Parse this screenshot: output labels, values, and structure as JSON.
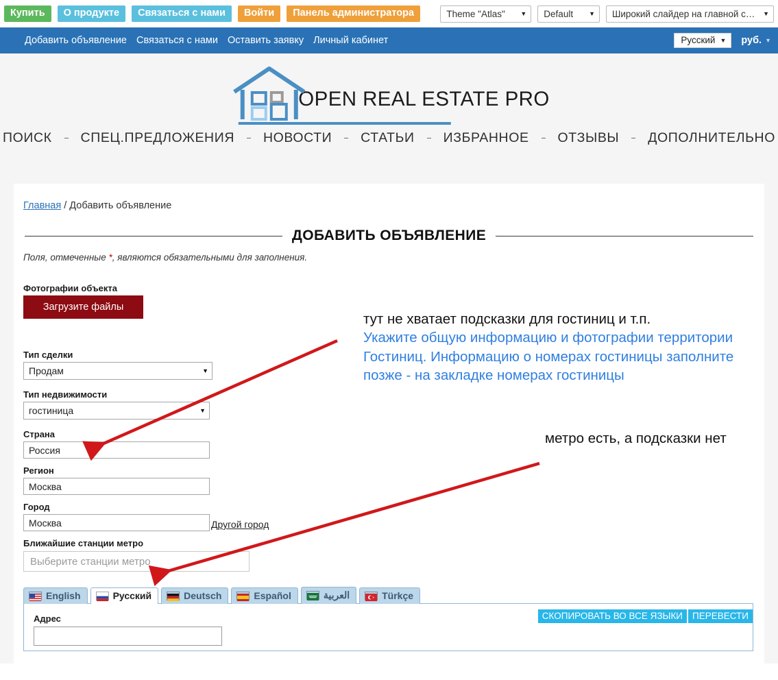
{
  "admin_bar": {
    "buttons": [
      {
        "label": "Купить",
        "color": "#5cb85c"
      },
      {
        "label": "О продукте",
        "color": "#5bc0de"
      },
      {
        "label": "Связаться с нами",
        "color": "#5bc0de"
      },
      {
        "label": "Войти",
        "color": "#efa03b"
      },
      {
        "label": "Панель администратора",
        "color": "#efa03b"
      }
    ],
    "selects": [
      {
        "value": "Theme \"Atlas\""
      },
      {
        "value": "Default"
      },
      {
        "value": "Широкий слайдер на главной страни"
      }
    ]
  },
  "top_nav": {
    "links": [
      "Добавить объявление",
      "Связаться с нами",
      "Оставить заявку",
      "Личный кабинет"
    ],
    "language": "Русский",
    "currency": "руб."
  },
  "logo": {
    "text": "OPEN REAL ESTATE PRO"
  },
  "main_nav": {
    "items": [
      "ПОИСК",
      "СПЕЦ.ПРЕДЛОЖЕНИЯ",
      "НОВОСТИ",
      "СТАТЬИ",
      "ИЗБРАННОЕ",
      "ОТЗЫВЫ",
      "ДОПОЛНИТЕЛЬНО"
    ]
  },
  "breadcrumb": {
    "home": "Главная",
    "separator": "/",
    "current": "Добавить объявление"
  },
  "page": {
    "title": "ДОБАВИТЬ ОБЪЯВЛЕНИЕ",
    "required_note_before": "Поля, отмеченные ",
    "required_star": "*",
    "required_note_after": ", являются обязательными для заполнения."
  },
  "form": {
    "photos_label": "Фотографии объекта",
    "upload_button": "Загрузите файлы",
    "deal_type_label": "Тип сделки",
    "deal_type_value": "Продам",
    "property_type_label": "Тип недвижимости",
    "property_type_value": "гостиница",
    "country_label": "Страна",
    "country_value": "Россия",
    "region_label": "Регион",
    "region_value": "Москва",
    "city_label": "Город",
    "city_value": "Москва",
    "other_city_link": "Другой город",
    "metro_label": "Ближайшие станции метро",
    "metro_placeholder": "Выберите станции метро"
  },
  "lang_tabs": [
    {
      "label": "English",
      "flag": "us",
      "active": false
    },
    {
      "label": "Русский",
      "flag": "ru",
      "active": true
    },
    {
      "label": "Deutsch",
      "flag": "de",
      "active": false
    },
    {
      "label": "Español",
      "flag": "es",
      "active": false
    },
    {
      "label": "العربية",
      "flag": "sa",
      "active": false
    },
    {
      "label": "Türkçe",
      "flag": "tr",
      "active": false
    }
  ],
  "tab_panel": {
    "address_label": "Адрес",
    "address_value": "",
    "copy_all_button": "СКОПИРОВАТЬ ВО ВСЕ ЯЗЫКИ",
    "translate_button": "ПЕРЕВЕСТИ"
  },
  "annotations": {
    "note1_black": "тут не хватает подсказки для гостиниц и т.п.",
    "note1_blue": "Укажите общую информацию и фотографии территории Гостиниц. Информацию о номерах гостиницы заполните позже - на закладке номерах гостиницы",
    "note2": "метро есть, а подсказки нет",
    "arrow_color": "#d0181b"
  }
}
